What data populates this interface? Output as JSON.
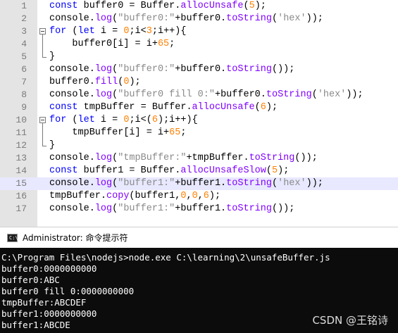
{
  "editor": {
    "highlighted_line": 15,
    "lines": [
      {
        "n": "1",
        "tokens": [
          {
            "t": "const",
            "c": "kw"
          },
          {
            "t": " buffer0 = Buffer.",
            "c": ""
          },
          {
            "t": "allocUnsafe",
            "c": "fn"
          },
          {
            "t": "(",
            "c": ""
          },
          {
            "t": "5",
            "c": "num"
          },
          {
            "t": ");",
            "c": ""
          }
        ]
      },
      {
        "n": "2",
        "tokens": [
          {
            "t": "console.",
            "c": ""
          },
          {
            "t": "log",
            "c": "fn"
          },
          {
            "t": "(",
            "c": ""
          },
          {
            "t": "\"buffer0:\"",
            "c": "str"
          },
          {
            "t": "+buffer0.",
            "c": ""
          },
          {
            "t": "toString",
            "c": "fn"
          },
          {
            "t": "(",
            "c": ""
          },
          {
            "t": "'hex'",
            "c": "str"
          },
          {
            "t": "));",
            "c": ""
          }
        ]
      },
      {
        "n": "3",
        "tokens": [
          {
            "t": "for",
            "c": "kw"
          },
          {
            "t": " (",
            "c": ""
          },
          {
            "t": "let",
            "c": "kw"
          },
          {
            "t": " i = ",
            "c": ""
          },
          {
            "t": "0",
            "c": "num"
          },
          {
            "t": ";i<",
            "c": ""
          },
          {
            "t": "3",
            "c": "num"
          },
          {
            "t": ";i++){",
            "c": ""
          }
        ]
      },
      {
        "n": "4",
        "tokens": [
          {
            "t": "    buffer0[i] = i+",
            "c": ""
          },
          {
            "t": "65",
            "c": "num"
          },
          {
            "t": ";",
            "c": ""
          }
        ]
      },
      {
        "n": "5",
        "tokens": [
          {
            "t": "}",
            "c": ""
          }
        ]
      },
      {
        "n": "6",
        "tokens": [
          {
            "t": "console.",
            "c": ""
          },
          {
            "t": "log",
            "c": "fn"
          },
          {
            "t": "(",
            "c": ""
          },
          {
            "t": "\"buffer0:\"",
            "c": "str"
          },
          {
            "t": "+buffer0.",
            "c": ""
          },
          {
            "t": "toString",
            "c": "fn"
          },
          {
            "t": "());",
            "c": ""
          }
        ]
      },
      {
        "n": "7",
        "tokens": [
          {
            "t": "buffer0.",
            "c": ""
          },
          {
            "t": "fill",
            "c": "fn"
          },
          {
            "t": "(",
            "c": ""
          },
          {
            "t": "0",
            "c": "num"
          },
          {
            "t": ");",
            "c": ""
          }
        ]
      },
      {
        "n": "8",
        "tokens": [
          {
            "t": "console.",
            "c": ""
          },
          {
            "t": "log",
            "c": "fn"
          },
          {
            "t": "(",
            "c": ""
          },
          {
            "t": "\"buffer0 fill 0:\"",
            "c": "str"
          },
          {
            "t": "+buffer0.",
            "c": ""
          },
          {
            "t": "toString",
            "c": "fn"
          },
          {
            "t": "(",
            "c": ""
          },
          {
            "t": "'hex'",
            "c": "str"
          },
          {
            "t": "));",
            "c": ""
          }
        ]
      },
      {
        "n": "9",
        "tokens": [
          {
            "t": "const",
            "c": "kw"
          },
          {
            "t": " tmpBuffer = Buffer.",
            "c": ""
          },
          {
            "t": "allocUnsafe",
            "c": "fn"
          },
          {
            "t": "(",
            "c": ""
          },
          {
            "t": "6",
            "c": "num"
          },
          {
            "t": ");",
            "c": ""
          }
        ]
      },
      {
        "n": "10",
        "tokens": [
          {
            "t": "for",
            "c": "kw"
          },
          {
            "t": " (",
            "c": ""
          },
          {
            "t": "let",
            "c": "kw"
          },
          {
            "t": " i = ",
            "c": ""
          },
          {
            "t": "0",
            "c": "num"
          },
          {
            "t": ";i<(",
            "c": ""
          },
          {
            "t": "6",
            "c": "num"
          },
          {
            "t": ");i++){",
            "c": ""
          }
        ]
      },
      {
        "n": "11",
        "tokens": [
          {
            "t": "    tmpBuffer[i] = i+",
            "c": ""
          },
          {
            "t": "65",
            "c": "num"
          },
          {
            "t": ";",
            "c": ""
          }
        ]
      },
      {
        "n": "12",
        "tokens": [
          {
            "t": "}",
            "c": ""
          }
        ]
      },
      {
        "n": "13",
        "tokens": [
          {
            "t": "console.",
            "c": ""
          },
          {
            "t": "log",
            "c": "fn"
          },
          {
            "t": "(",
            "c": ""
          },
          {
            "t": "\"tmpBuffer:\"",
            "c": "str"
          },
          {
            "t": "+tmpBuffer.",
            "c": ""
          },
          {
            "t": "toString",
            "c": "fn"
          },
          {
            "t": "());",
            "c": ""
          }
        ]
      },
      {
        "n": "14",
        "tokens": [
          {
            "t": "const",
            "c": "kw"
          },
          {
            "t": " buffer1 = Buffer.",
            "c": ""
          },
          {
            "t": "allocUnsafeSlow",
            "c": "fn"
          },
          {
            "t": "(",
            "c": ""
          },
          {
            "t": "5",
            "c": "num"
          },
          {
            "t": ");",
            "c": ""
          }
        ]
      },
      {
        "n": "15",
        "tokens": [
          {
            "t": "console.",
            "c": ""
          },
          {
            "t": "log",
            "c": "fn"
          },
          {
            "t": "(",
            "c": ""
          },
          {
            "t": "\"buffer1:\"",
            "c": "str"
          },
          {
            "t": "+buffer1.",
            "c": ""
          },
          {
            "t": "toString",
            "c": "fn"
          },
          {
            "t": "(",
            "c": ""
          },
          {
            "t": "'hex'",
            "c": "str"
          },
          {
            "t": "));",
            "c": ""
          }
        ]
      },
      {
        "n": "16",
        "tokens": [
          {
            "t": "tmpBuffer.",
            "c": ""
          },
          {
            "t": "copy",
            "c": "fn"
          },
          {
            "t": "(buffer1,",
            "c": ""
          },
          {
            "t": "0",
            "c": "num"
          },
          {
            "t": ",",
            "c": ""
          },
          {
            "t": "0",
            "c": "num"
          },
          {
            "t": ",",
            "c": ""
          },
          {
            "t": "6",
            "c": "num"
          },
          {
            "t": ");",
            "c": ""
          }
        ]
      },
      {
        "n": "17",
        "tokens": [
          {
            "t": "console.",
            "c": ""
          },
          {
            "t": "log",
            "c": "fn"
          },
          {
            "t": "(",
            "c": ""
          },
          {
            "t": "\"buffer1:\"",
            "c": "str"
          },
          {
            "t": "+buffer1.",
            "c": ""
          },
          {
            "t": "toString",
            "c": "fn"
          },
          {
            "t": "());",
            "c": ""
          }
        ]
      }
    ]
  },
  "console": {
    "title": "Administrator: 命令提示符",
    "icon_label": "C:\\",
    "output": [
      "C:\\Program Files\\nodejs>node.exe C:\\learning\\2\\unsafeBuffer.js",
      "buffer0:0000000000",
      "buffer0:ABC",
      "buffer0 fill 0:0000000000",
      "tmpBuffer:ABCDEF",
      "buffer1:0000000000",
      "buffer1:ABCDE"
    ]
  },
  "watermark": "CSDN @王铭诗",
  "colors": {
    "keyword": "#0000ff",
    "string": "#8a8a8a",
    "number": "#ff8000",
    "function": "#8000ff",
    "console_bg": "#0c0c0c",
    "highlight": "#e8e8ff"
  }
}
